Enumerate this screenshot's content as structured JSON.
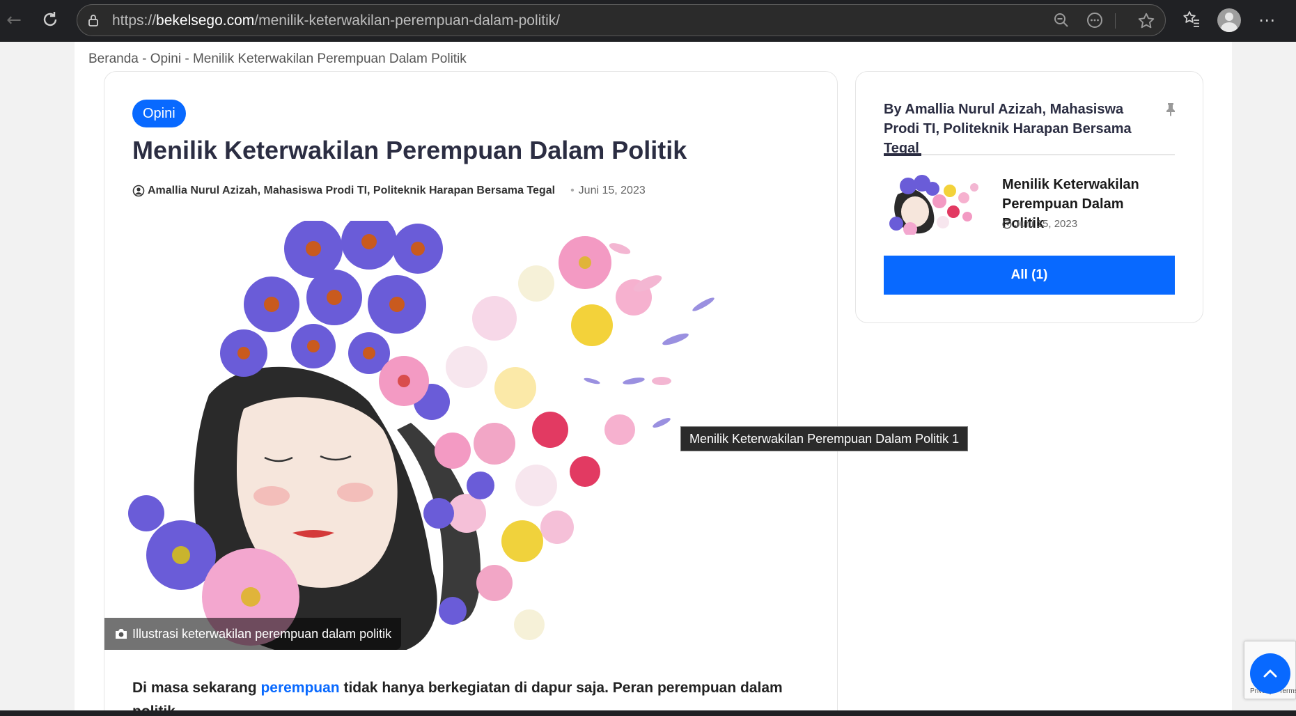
{
  "browser": {
    "url_prefix": "https://",
    "url_host": "bekelsego.com",
    "url_path": "/menilik-keterwakilan-perempuan-dalam-politik/"
  },
  "breadcrumb": "Beranda - Opini - Menilik Keterwakilan Perempuan Dalam Politik",
  "article": {
    "category": "Opini",
    "title": "Menilik Keterwakilan Perempuan Dalam Politik",
    "author": "Amallia Nurul Azizah, Mahasiswa Prodi TI, Politeknik Harapan Bersama Tegal",
    "date": "Juni 15, 2023",
    "image_caption": "Illustrasi keterwakilan perempuan dalam politik",
    "body_start": "Di masa sekarang ",
    "body_link": "perempuan",
    "body_rest": " tidak hanya berkegiatan di dapur saja. Peran perempuan dalam politik"
  },
  "tooltip": "Menilik Keterwakilan Perempuan Dalam Politik 1",
  "sidebar": {
    "title": "By Amallia Nurul Azizah, Mahasiswa Prodi TI, Politeknik Harapan Bersama Tegal",
    "post_title": "Menilik Keterwakilan Perempuan Dalam Politik",
    "post_date": "Juni 15, 2023",
    "all_button": "All (1)"
  },
  "recaptcha": {
    "terms": "Privacy - Terms"
  },
  "colors": {
    "accent": "#0869ff",
    "title": "#2b2d42"
  }
}
